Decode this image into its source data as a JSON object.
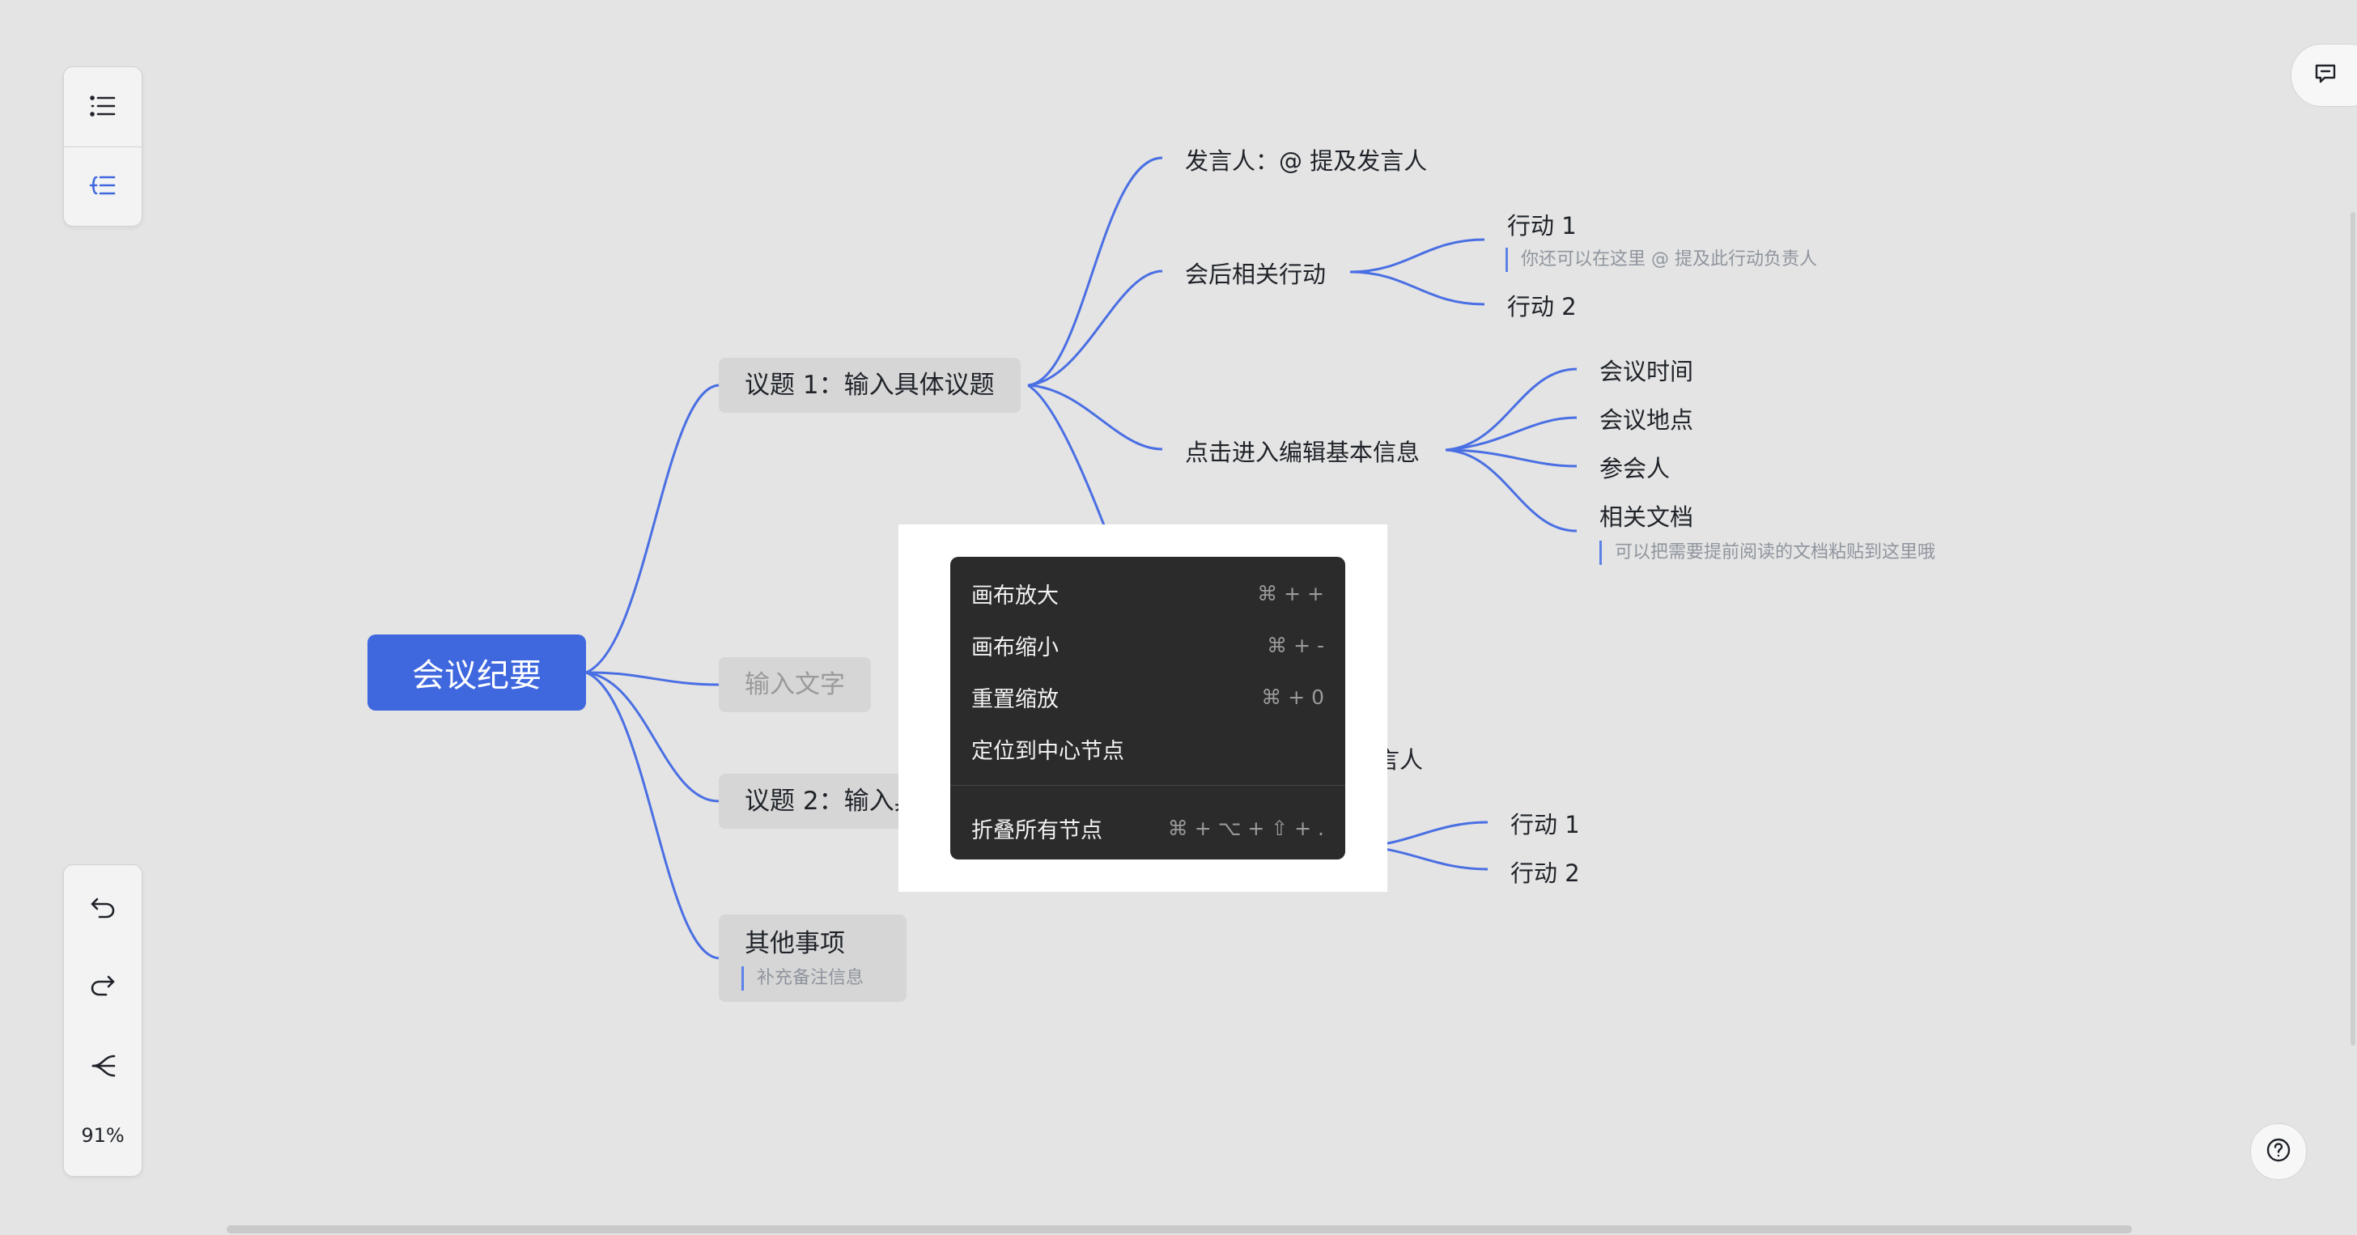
{
  "mindmap": {
    "root": "会议纪要",
    "topic1": "议题 1：输入具体议题",
    "speaker": "发言人：@ 提及发言人",
    "followup": "会后相关行动",
    "action1": "行动 1",
    "action1_note": "你还可以在这里 @ 提及此行动负责人",
    "action2": "行动 2",
    "basic_info": "点击进入编辑基本信息",
    "meeting_time": "会议时间",
    "meeting_place": "会议地点",
    "participants": "参会人",
    "related_docs": "相关文档",
    "docs_note": "可以把需要提前阅读的文档粘贴到这里哦",
    "input_text": "输入文字",
    "topic2": "议题 2：输入具体",
    "speaker2_partial": "及发言人",
    "t2_action1": "行动 1",
    "t2_action2": "行动 2",
    "other": "其他事项",
    "other_note": "补充备注信息"
  },
  "context_menu": {
    "items": [
      {
        "label": "画布放大",
        "shortcut": "⌘ + +"
      },
      {
        "label": "画布缩小",
        "shortcut": "⌘ + -"
      },
      {
        "label": "重置缩放",
        "shortcut": "⌘ + 0"
      },
      {
        "label": "定位到中心节点",
        "shortcut": ""
      },
      {
        "label": "折叠所有节点",
        "shortcut": "⌘ + ⌥ + ⇧ + ."
      }
    ]
  },
  "toolbar_top": {
    "icons": [
      "outline-icon",
      "layout-icon"
    ]
  },
  "toolbar_bottom": {
    "icons": [
      "undo-icon",
      "redo-icon",
      "structure-icon"
    ],
    "zoom": "91%"
  },
  "colors": {
    "branch": "#4a6fe3",
    "root_bg": "#3f68df",
    "canvas": "#e4e4e4",
    "menu_bg": "#2b2b2b"
  }
}
